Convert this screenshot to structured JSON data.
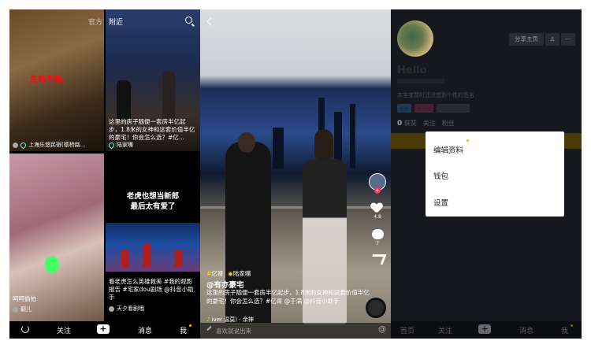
{
  "feed": {
    "tabs": [
      "官方",
      "附近"
    ],
    "cards": [
      {
        "overlay": "生蚝不错。",
        "location": "上海乐悠民宿(德桥路..."
      },
      {
        "caption": "这里的房子随便一套房半亿起步，1.8米的女神和这套价值半亿的豪宅！你会怎么选？#亿...",
        "location": "陆家嘴"
      },
      {
        "caption": "呵呵偷拍",
        "user": "巅儿"
      },
      {
        "title_line1": "老虎也想当新郎",
        "title_line2": "最后太有爱了",
        "caption": "看老虎怎么英雄救美 #我的观影报告 #宅家dou剧场 @抖音小助手",
        "user": "天夕看剧哦"
      }
    ],
    "nav": {
      "follow": "关注",
      "plus": "+",
      "messages": "消息",
      "me": "我"
    }
  },
  "video": {
    "tag_hash": "#",
    "tag1": "亿哥",
    "tag2": "陆家嘴",
    "author": "@有亦豪宅",
    "description": "这里的房子随便一套房半亿起步，1.8米的女神和这套价值半亿的豪宅！你会怎么选？#亿哥 @于满 @抖音小助手",
    "music": "iver 温莫) - 余神",
    "likes": "4.8",
    "comments": "7",
    "comment_placeholder": "喜欢就说出来"
  },
  "profile": {
    "share_button": "分享主页",
    "name": "Hello",
    "signature": "本宝宝暂时还没想到个性的签名",
    "tags": [
      "年龄",
      "在上海",
      "添加学校信息"
    ],
    "stats": {
      "likes_num": "0",
      "likes_label": "获赞",
      "following": "关注",
      "fans": "粉丝"
    },
    "menu": [
      "编辑资料",
      "钱包",
      "设置"
    ],
    "nav": {
      "home": "首页",
      "follow": "关注",
      "plus": "+",
      "messages": "消息",
      "me": "我"
    }
  }
}
